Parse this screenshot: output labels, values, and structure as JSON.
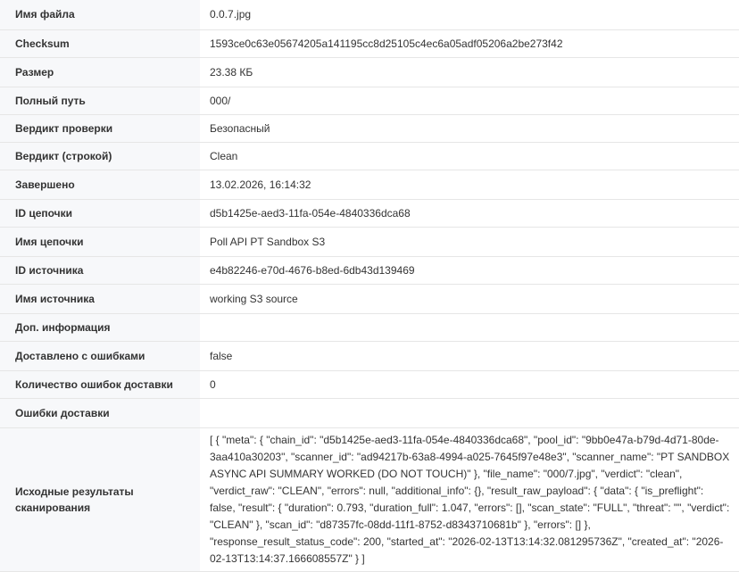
{
  "rows": [
    {
      "key": "Имя файла",
      "value": "0.0.7.jpg"
    },
    {
      "key": "Checksum",
      "value": "1593ce0c63e05674205a141195cc8d25105c4ec6a05adf05206a2be273f42"
    },
    {
      "key": "Размер",
      "value": "23.38 КБ"
    },
    {
      "key": "Полный путь",
      "value": "000/"
    },
    {
      "key": "Вердикт проверки",
      "value": "Безопасный"
    },
    {
      "key": "Вердикт (строкой)",
      "value": "Clean"
    },
    {
      "key": "Завершено",
      "value": "13.02.2026, 16:14:32"
    },
    {
      "key": "ID цепочки",
      "value": "d5b1425e-aed3-11fa-054e-4840336dca68"
    },
    {
      "key": "Имя цепочки",
      "value": "Poll API PT Sandbox S3"
    },
    {
      "key": "ID источника",
      "value": "e4b82246-e70d-4676-b8ed-6db43d139469"
    },
    {
      "key": "Имя источника",
      "value": "working S3 source"
    },
    {
      "key": "Доп. информация",
      "value": ""
    },
    {
      "key": "Доставлено с ошибками",
      "value": "false"
    },
    {
      "key": "Количество ошибок доставки",
      "value": "0"
    },
    {
      "key": "Ошибки доставки",
      "value": ""
    },
    {
      "key": "Исходные результаты сканирования",
      "value": "[ { \"meta\": { \"chain_id\": \"d5b1425e-aed3-11fa-054e-4840336dca68\", \"pool_id\": \"9bb0e47a-b79d-4d71-80de-3aa410a30203\", \"scanner_id\": \"ad94217b-63a8-4994-a025-7645f97e48e3\", \"scanner_name\": \"PT SANDBOX ASYNC API SUMMARY WORKED (DO NOT TOUCH)\" }, \"file_name\": \"000/7.jpg\", \"verdict\": \"clean\", \"verdict_raw\": \"CLEAN\", \"errors\": null, \"additional_info\": {}, \"result_raw_payload\": { \"data\": { \"is_preflight\": false, \"result\": { \"duration\": 0.793, \"duration_full\": 1.047, \"errors\": [], \"scan_state\": \"FULL\", \"threat\": \"\", \"verdict\": \"CLEAN\" }, \"scan_id\": \"d87357fc-08dd-11f1-8752-d8343710681b\" }, \"errors\": [] }, \"response_result_status_code\": 200, \"started_at\": \"2026-02-13T13:14:32.081295736Z\", \"created_at\": \"2026-02-13T13:14:37.166608557Z\" } ]"
    }
  ]
}
